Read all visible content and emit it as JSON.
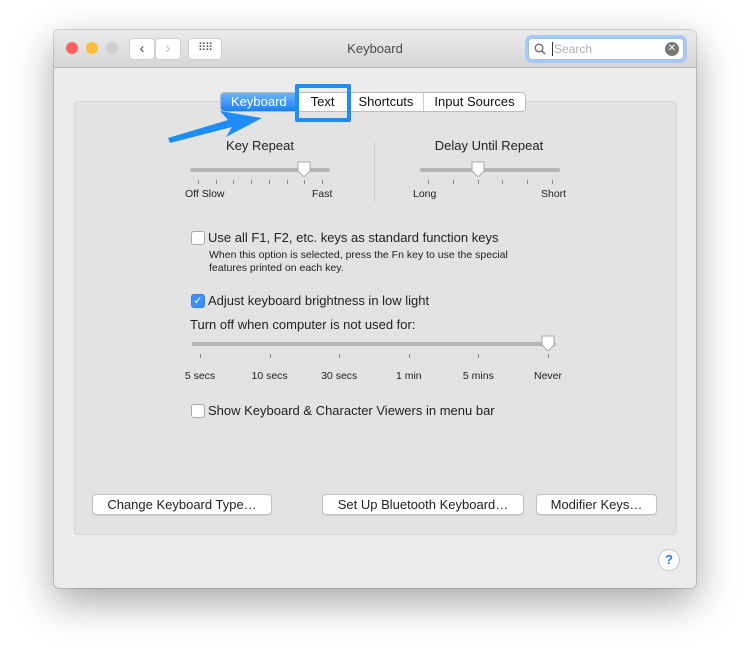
{
  "window": {
    "title": "Keyboard",
    "search": {
      "placeholder": "Search",
      "value": ""
    }
  },
  "tabs": [
    {
      "label": "Keyboard",
      "selected": true
    },
    {
      "label": "Text",
      "highlighted": true
    },
    {
      "label": "Shortcuts"
    },
    {
      "label": "Input Sources"
    }
  ],
  "key_repeat": {
    "title": "Key Repeat",
    "min_label": "Off Slow",
    "max_label": "Fast",
    "ticks": 8,
    "value_index": 6
  },
  "delay_until_repeat": {
    "title": "Delay Until Repeat",
    "min_label": "Long",
    "max_label": "Short",
    "ticks": 6,
    "value_index": 2
  },
  "function_keys": {
    "label": "Use all F1, F2, etc. keys as standard function keys",
    "checked": false,
    "help_line1": "When this option is selected, press the Fn key to use the special",
    "help_line2": "features printed on each key."
  },
  "brightness": {
    "label": "Adjust keyboard brightness in low light",
    "checked": true,
    "turn_off_label": "Turn off when computer is not used for:",
    "ticks": [
      "5 secs",
      "10 secs",
      "30 secs",
      "1 min",
      "5 mins",
      "Never"
    ],
    "value_index": 5
  },
  "viewers": {
    "label": "Show Keyboard & Character Viewers in menu bar",
    "checked": false
  },
  "buttons": {
    "change_type": "Change Keyboard Type…",
    "bluetooth": "Set Up Bluetooth Keyboard…",
    "modifier": "Modifier Keys…",
    "help": "?"
  },
  "colors": {
    "accent": "#1a82fb",
    "annotation": "#1e8df7"
  }
}
